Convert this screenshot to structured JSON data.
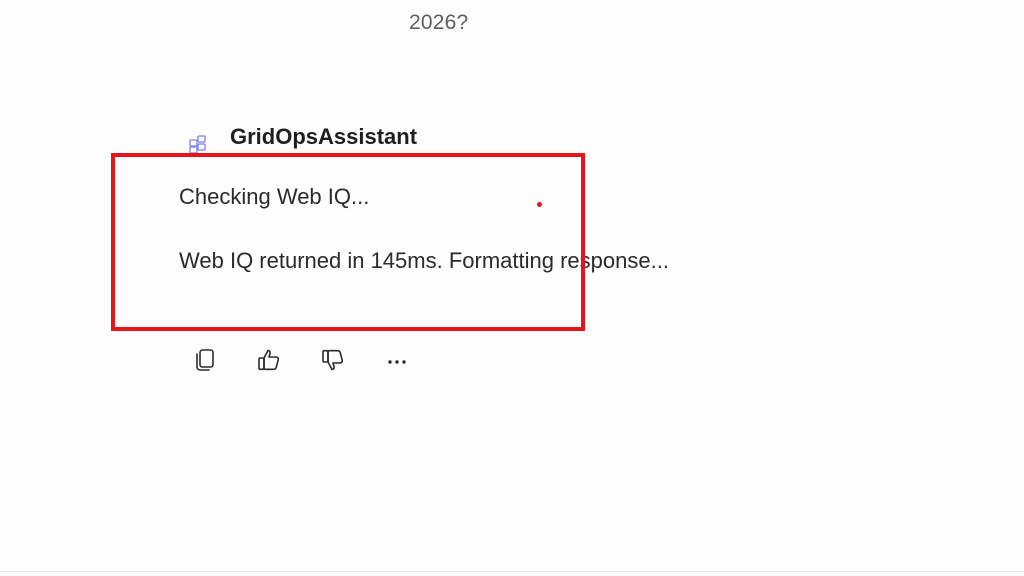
{
  "conversation": {
    "previous_user_message_fragment": "2026?",
    "assistant": {
      "name": "GridOpsAssistant",
      "icon": "apps-grid-icon",
      "status_lines": [
        "Checking Web IQ...",
        "Web IQ returned in 145ms. Formatting response..."
      ]
    },
    "actions": [
      {
        "name": "copy",
        "icon": "copy-icon"
      },
      {
        "name": "like",
        "icon": "thumbs-up-icon"
      },
      {
        "name": "dislike",
        "icon": "thumbs-down-icon"
      },
      {
        "name": "more",
        "icon": "more-horizontal-icon"
      }
    ]
  },
  "annotation": {
    "highlight_color": "#e8141b"
  }
}
